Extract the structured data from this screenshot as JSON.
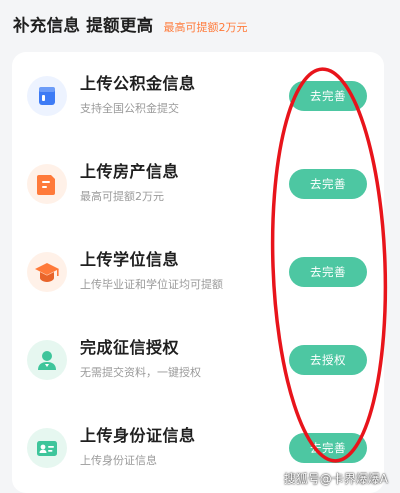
{
  "header": {
    "title": "补充信息 提额更高",
    "subtitle": "最高可提额2万元",
    "subtitle_color": "#ff7a3a"
  },
  "items": [
    {
      "title": "上传公积金信息",
      "subtitle": "支持全国公积金提交",
      "button": "去完善",
      "icon": "housing-fund-card-icon",
      "icon_color": "#3d7bf5"
    },
    {
      "title": "上传房产信息",
      "subtitle": "最高可提额2万元",
      "button": "去完善",
      "icon": "property-document-icon",
      "icon_color": "#ff7a3a"
    },
    {
      "title": "上传学位信息",
      "subtitle": "上传毕业证和学位证均可提额",
      "button": "去完善",
      "icon": "graduation-cap-icon",
      "icon_color": "#ff7a3a"
    },
    {
      "title": "完成征信授权",
      "subtitle": "无需提交资料，一键授权",
      "button": "去授权",
      "icon": "user-authorization-icon",
      "icon_color": "#3ec59b"
    },
    {
      "title": "上传身份证信息",
      "subtitle": "上传身份证信息",
      "button": "去完善",
      "icon": "id-card-icon",
      "icon_color": "#3ec59b"
    }
  ],
  "button_color": "#4dc7a2",
  "annotation_color": "#e8141b",
  "watermark": "搜狐号@卡界爆爆A"
}
